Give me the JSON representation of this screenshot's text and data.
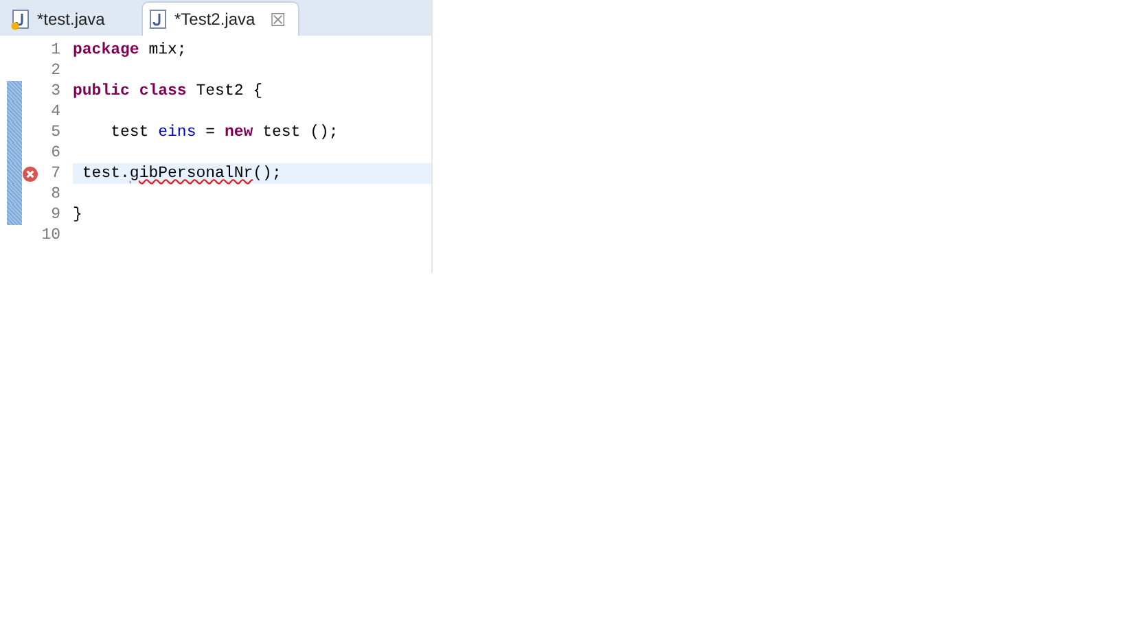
{
  "tabs": [
    {
      "label": "*test.java",
      "selected": false,
      "warning": true
    },
    {
      "label": "*Test2.java",
      "selected": true,
      "warning": false,
      "close": "☒"
    }
  ],
  "lines": [
    {
      "number": "1",
      "changed": false,
      "current": false,
      "error": false,
      "tokens": [
        {
          "text": "package",
          "kind": "keyword"
        },
        {
          "text": " mix;",
          "kind": "plain"
        }
      ]
    },
    {
      "number": "2",
      "changed": false,
      "current": false,
      "error": false
    },
    {
      "number": "3",
      "changed": true,
      "current": false,
      "error": false,
      "tokens": [
        {
          "text": "public",
          "kind": "keyword"
        },
        {
          "text": " class",
          "kind": "keyword"
        },
        {
          "text": " Test2 {",
          "kind": "plain"
        }
      ]
    },
    {
      "number": "4",
      "changed": true,
      "current": false,
      "error": false
    },
    {
      "number": "5",
      "changed": true,
      "current": false,
      "error": false,
      "tokens": [
        {
          "text": "    test ",
          "kind": "plain"
        },
        {
          "text": "eins",
          "kind": "field"
        },
        {
          "text": " = ",
          "kind": "plain"
        },
        {
          "text": "new",
          "kind": "keyword"
        },
        {
          "text": " test ();",
          "kind": "plain"
        }
      ]
    },
    {
      "number": "6",
      "changed": true,
      "current": false,
      "error": false
    },
    {
      "number": "7",
      "changed": true,
      "current": true,
      "error": true,
      "tokens": [
        {
          "text": " test.",
          "kind": "plain"
        },
        {
          "text": "gibPersonalNr",
          "kind": "error"
        },
        {
          "text": "();",
          "kind": "plain"
        }
      ]
    },
    {
      "number": "8",
      "changed": true,
      "current": false,
      "error": false
    },
    {
      "number": "9",
      "changed": true,
      "current": false,
      "error": false,
      "tokens": [
        {
          "text": "}",
          "kind": "plain"
        }
      ]
    },
    {
      "number": "10",
      "changed": false,
      "current": false,
      "error": false
    }
  ]
}
